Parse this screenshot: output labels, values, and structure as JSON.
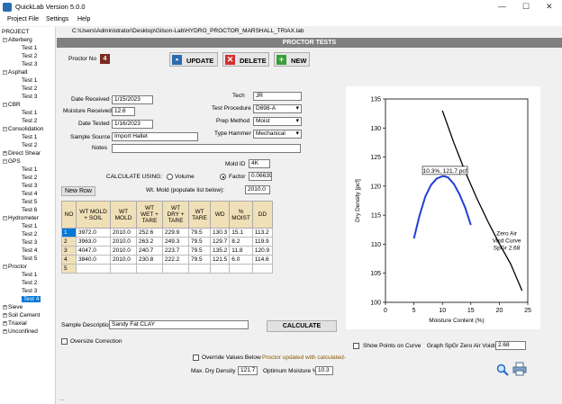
{
  "window": {
    "title": "QuickLab  Version 5.0.0",
    "minimize": "—",
    "maximize": "☐",
    "close": "✕"
  },
  "menu": [
    "Project File",
    "Settings",
    "Help"
  ],
  "path": "C:\\Users\\Administrator\\Desktop\\Gilson-Lab\\HYDRO_PROCTOR_MARSHALL_TRIAX.lab",
  "banner": "PROCTOR TESTS",
  "tree": {
    "root": "PROJECT",
    "groups": [
      {
        "name": "Atterberg",
        "items": [
          "Test 1",
          "Test 2",
          "Test 3"
        ]
      },
      {
        "name": "Asphalt",
        "items": [
          "Test 1",
          "Test 2",
          "Test 3"
        ]
      },
      {
        "name": "CBR",
        "items": [
          "Test 1",
          "Test 2"
        ]
      },
      {
        "name": "Consolidation",
        "items": [
          "Test 1",
          "Test 2"
        ]
      },
      {
        "name": "Direct Shear",
        "items": []
      },
      {
        "name": "GPS",
        "items": [
          "Test 1",
          "Test 2",
          "Test 3",
          "Test 4",
          "Test 5",
          "Test 6"
        ]
      },
      {
        "name": "Hydrometer",
        "items": [
          "Test 1",
          "Test 2",
          "Test 3",
          "Test 4",
          "Test 5"
        ]
      },
      {
        "name": "Proctor",
        "items": [
          "Test 1",
          "Test 2",
          "Test 3",
          "Test 4"
        ]
      },
      {
        "name": "Sieve",
        "items": []
      },
      {
        "name": "Soil Cement",
        "items": []
      },
      {
        "name": "Triaxial",
        "items": []
      },
      {
        "name": "Unconfined",
        "items": []
      }
    ],
    "selected": "Proctor/Test 4"
  },
  "proctor_no_label": "Proctor No",
  "proctor_no": "4",
  "buttons": {
    "update": "UPDATE",
    "delete": "DELETE",
    "new": "NEW",
    "new_row": "New Row",
    "calculate": "CALCULATE"
  },
  "form": {
    "date_received_label": "Date Received",
    "date_received": "1/15/2023",
    "moisture_received_label": "Moisture Received",
    "moisture_received": "12.6",
    "date_tested_label": "Date Tested",
    "date_tested": "1/16/2023",
    "sample_source_label": "Sample Source",
    "sample_source": "Import Hallet",
    "notes_label": "Notes",
    "notes": "",
    "tech_label": "Tech",
    "tech": "JR",
    "test_procedure_label": "Test Procedure",
    "test_procedure": "D698-A",
    "prep_method_label": "Prep Method",
    "prep_method": "Moist",
    "type_hammer_label": "Type Hammer",
    "type_hammer": "Mechanical",
    "mold_id_label": "Mold ID",
    "mold_id": "4K",
    "calc_using_label": "CALCULATE USING:",
    "volume_label": "Volume",
    "factor_label": "Factor",
    "factor": "0.06639",
    "wt_mold_label": "Wt. Mold (populate list below):",
    "wt_mold": "2010.0",
    "sample_description_label": "Sample Description",
    "sample_description": "Sandy Fat CLAY",
    "oversize_label": "Oversize Correction",
    "override_label": "Override Values Below",
    "status_message": "Proctor updated with calculated-",
    "max_dry_density_label": "Max. Dry Density",
    "max_dry_density": "121.7",
    "optimum_moisture_label": "Optimum Moisture %",
    "optimum_moisture": "10.3",
    "show_points_label": "Show Points on Curve",
    "graph_spgr_label": "Graph SpGr Zero Air Voids:",
    "graph_spgr": "2.68",
    "footer": "..."
  },
  "table": {
    "headers": [
      "NO",
      "WT MOLD + SOIL",
      "WT MOLD",
      "WT WET + TARE",
      "WT DRY + TARE",
      "WT TARE",
      "WD",
      "% MOIST",
      "DD"
    ],
    "rows": [
      [
        "1",
        "3972.0",
        "2010.0",
        "252.6",
        "229.9",
        "79.5",
        "130.3",
        "15.1",
        "113.2"
      ],
      [
        "2",
        "3963.0",
        "2010.0",
        "263.2",
        "249.3",
        "79.5",
        "129.7",
        "8.2",
        "119.9"
      ],
      [
        "3",
        "4047.0",
        "2010.0",
        "240.7",
        "223.7",
        "79.5",
        "135.2",
        "11.8",
        "120.9"
      ],
      [
        "4",
        "3840.0",
        "2010.0",
        "230.8",
        "222.2",
        "79.5",
        "121.5",
        "6.0",
        "114.6"
      ],
      [
        "5",
        "",
        "",
        "",
        "",
        "",
        "",
        "",
        ""
      ]
    ]
  },
  "chart_data": {
    "type": "line",
    "xlabel": "Moisture Content (%)",
    "ylabel": "Dry Density [pcf]",
    "xlim": [
      0,
      25
    ],
    "ylim": [
      100,
      135
    ],
    "xticks": [
      0,
      5,
      10,
      15,
      20,
      25
    ],
    "yticks": [
      100,
      105,
      110,
      115,
      120,
      125,
      130,
      135
    ],
    "grid": false,
    "series": [
      {
        "name": "",
        "color": "#1f3fd6",
        "x": [
          5,
          6,
          7,
          8,
          9,
          10,
          10.3,
          11,
          12,
          13,
          14,
          15
        ],
        "y": [
          111,
          115,
          118.2,
          120.2,
          121.3,
          121.7,
          121.7,
          121.5,
          120.4,
          118.6,
          116.3,
          113.3
        ]
      },
      {
        "name": "Zero Air Void Curve SpGr 2.68",
        "color": "#000000",
        "x": [
          10,
          12,
          14,
          16,
          18,
          20,
          22,
          24
        ],
        "y": [
          133,
          127.5,
          122.5,
          118.0,
          113.9,
          110.1,
          106.6,
          102.0
        ]
      }
    ],
    "annotations": [
      {
        "text": "10.3%, 121.7 pcf",
        "x": 10.3,
        "y": 121.7
      },
      {
        "text": "Zero Air Void Curve SpGr 2.68",
        "x": 20,
        "y": 111
      }
    ],
    "zav_lines": [
      "Zero Air",
      "Void Curve",
      "SpGr 2.68"
    ],
    "colors": {
      "compaction": "#1f3fd6",
      "zav": "#000000"
    }
  }
}
